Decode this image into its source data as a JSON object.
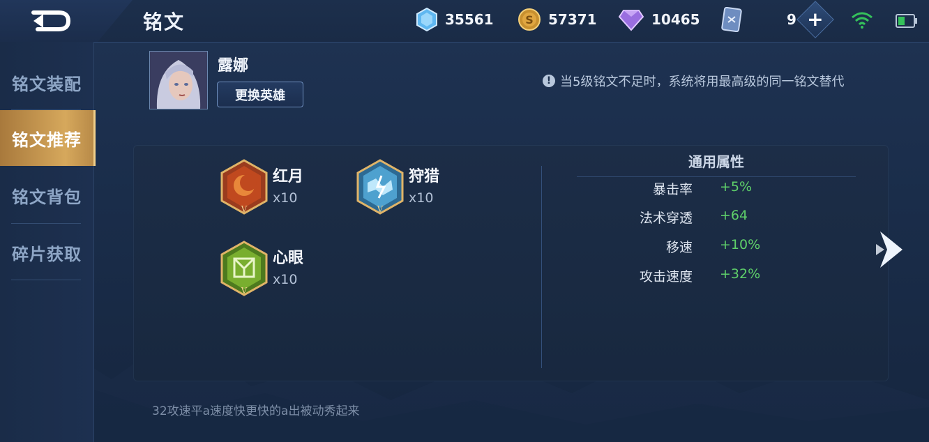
{
  "header": {
    "title": "铭文",
    "resources": [
      {
        "icon": "crystal-icon",
        "value": "35561"
      },
      {
        "icon": "gold-coin-icon",
        "value": "57371"
      },
      {
        "icon": "diamond-icon",
        "value": "10465"
      },
      {
        "icon": "card-icon",
        "value": "9"
      }
    ],
    "plus_label": "+"
  },
  "sidebar": {
    "items": [
      {
        "label": "铭文装配",
        "active": false
      },
      {
        "label": "铭文推荐",
        "active": true
      },
      {
        "label": "铭文背包",
        "active": false
      },
      {
        "label": "碎片获取",
        "active": false
      }
    ]
  },
  "hero": {
    "name": "露娜",
    "swap_label": "更换英雄"
  },
  "notice": {
    "icon": "!",
    "text": "当5级铭文不足时，系统将用最高级的同一铭文替代"
  },
  "runes": [
    {
      "name": "红月",
      "count": "x10",
      "color": "red",
      "icon": "red-moon-rune-icon"
    },
    {
      "name": "狩猎",
      "count": "x10",
      "color": "blue",
      "icon": "hunt-rune-icon"
    },
    {
      "name": "心眼",
      "count": "x10",
      "color": "green",
      "icon": "mind-eye-rune-icon"
    }
  ],
  "attributes": {
    "title": "通用属性",
    "rows": [
      {
        "label": "暴击率",
        "value": "+5%"
      },
      {
        "label": "法术穿透",
        "value": "+64"
      },
      {
        "label": "移速",
        "value": "+10%"
      },
      {
        "label": "攻击速度",
        "value": "+32%"
      }
    ]
  },
  "footer": {
    "note": "32攻速平a速度快更快的a出被动秀起来"
  },
  "colors": {
    "accent_gold": "#d6a85c",
    "positive_green": "#5fd06a",
    "background": "#1a2d4a"
  }
}
